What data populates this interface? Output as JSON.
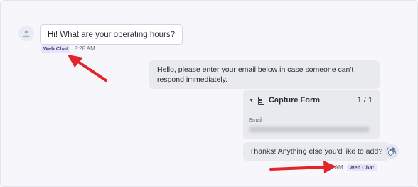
{
  "conversation": {
    "visitor_message": {
      "text": "Hi! What are your operating hours?",
      "channel": "Web Chat",
      "time": "8:28 AM"
    },
    "agent_message": {
      "text": "Hello, please enter your email below in case someone can't respond immediately."
    },
    "capture_form": {
      "title": "Capture Form",
      "count": "1 / 1",
      "field_label": "Email"
    },
    "agent_followup": {
      "text": "Thanks! Anything else you'd like to add?",
      "time": "29 AM",
      "channel": "Web Chat"
    }
  },
  "icons": {
    "visitor_avatar": "user-icon",
    "agent_avatar": "waving-hand-icon",
    "form": "document-icon",
    "collapse": "caret-down-icon"
  },
  "colors": {
    "annotation_arrow": "#e0262b",
    "badge_bg": "#e9e3f7",
    "agent_bubble": "#e9eaee"
  }
}
